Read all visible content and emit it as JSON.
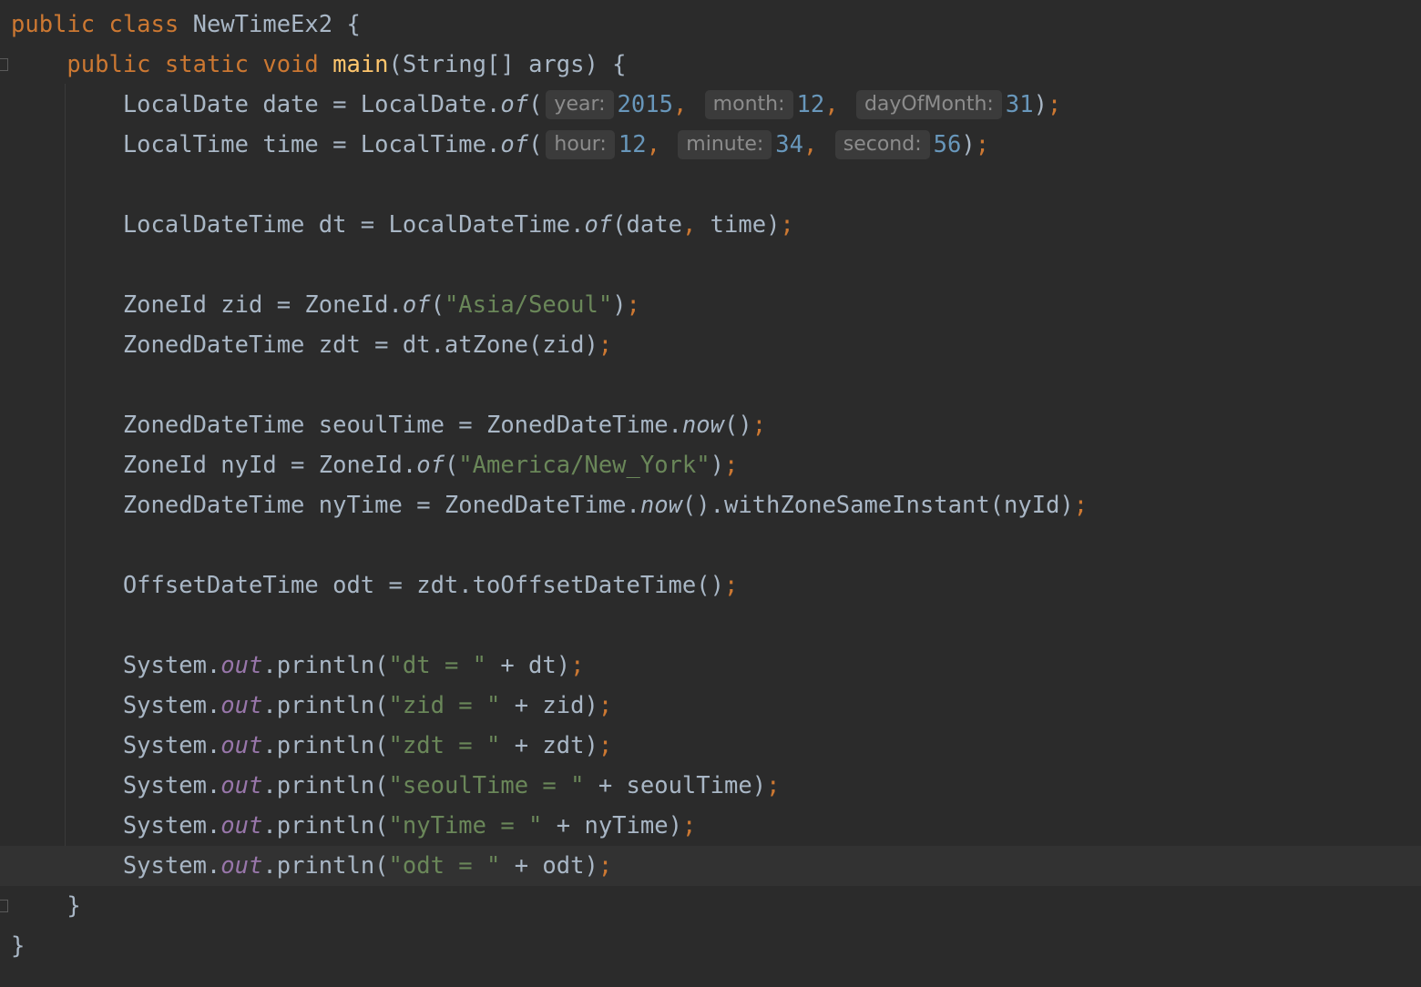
{
  "editor": {
    "lines": [
      {
        "tokens": [
          [
            "kw",
            "public "
          ],
          [
            "kw",
            "class "
          ],
          [
            "",
            "NewTimeEx2 {"
          ]
        ]
      },
      {
        "tokens": [
          [
            "",
            "    "
          ],
          [
            "kw",
            "public "
          ],
          [
            "kw",
            "static "
          ],
          [
            "kw",
            "void "
          ],
          [
            "fn",
            "main"
          ],
          [
            "",
            "(String[] args) {"
          ]
        ]
      },
      {
        "tokens": [
          [
            "",
            "        LocalDate date = LocalDate."
          ],
          [
            "it",
            "of"
          ],
          [
            "",
            "("
          ],
          [
            "hint",
            "year:"
          ],
          [
            "nu",
            "2015"
          ],
          [
            "cm",
            ", "
          ],
          [
            "hint",
            "month:"
          ],
          [
            "nu",
            "12"
          ],
          [
            "cm",
            ", "
          ],
          [
            "hint",
            "dayOfMonth:"
          ],
          [
            "nu",
            "31"
          ],
          [
            "",
            ")"
          ],
          [
            "semi",
            ";"
          ]
        ]
      },
      {
        "tokens": [
          [
            "",
            "        LocalTime time = LocalTime."
          ],
          [
            "it",
            "of"
          ],
          [
            "",
            "("
          ],
          [
            "hint",
            "hour:"
          ],
          [
            "nu",
            "12"
          ],
          [
            "cm",
            ", "
          ],
          [
            "hint",
            "minute:"
          ],
          [
            "nu",
            "34"
          ],
          [
            "cm",
            ", "
          ],
          [
            "hint",
            "second:"
          ],
          [
            "nu",
            "56"
          ],
          [
            "",
            ")"
          ],
          [
            "semi",
            ";"
          ]
        ]
      },
      {
        "tokens": []
      },
      {
        "tokens": [
          [
            "",
            "        LocalDateTime dt = LocalDateTime."
          ],
          [
            "it",
            "of"
          ],
          [
            "",
            "(date"
          ],
          [
            "cm",
            ", "
          ],
          [
            "",
            "time)"
          ],
          [
            "semi",
            ";"
          ]
        ]
      },
      {
        "tokens": []
      },
      {
        "tokens": [
          [
            "",
            "        ZoneId zid = ZoneId."
          ],
          [
            "it",
            "of"
          ],
          [
            "",
            "("
          ],
          [
            "st",
            "\"Asia/Seoul\""
          ],
          [
            "",
            ")"
          ],
          [
            "semi",
            ";"
          ]
        ]
      },
      {
        "tokens": [
          [
            "",
            "        ZonedDateTime zdt = dt.atZone(zid)"
          ],
          [
            "semi",
            ";"
          ]
        ]
      },
      {
        "tokens": []
      },
      {
        "tokens": [
          [
            "",
            "        ZonedDateTime seoulTime = ZonedDateTime."
          ],
          [
            "it",
            "now"
          ],
          [
            "",
            "()"
          ],
          [
            "semi",
            ";"
          ]
        ]
      },
      {
        "tokens": [
          [
            "",
            "        ZoneId nyId = ZoneId."
          ],
          [
            "it",
            "of"
          ],
          [
            "",
            "("
          ],
          [
            "st",
            "\"America/New_York\""
          ],
          [
            "",
            ")"
          ],
          [
            "semi",
            ";"
          ]
        ]
      },
      {
        "tokens": [
          [
            "",
            "        ZonedDateTime nyTime = ZonedDateTime."
          ],
          [
            "it",
            "now"
          ],
          [
            "",
            "().withZoneSameInstant(nyId)"
          ],
          [
            "semi",
            ";"
          ]
        ]
      },
      {
        "tokens": []
      },
      {
        "tokens": [
          [
            "",
            "        OffsetDateTime odt = zdt.toOffsetDateTime()"
          ],
          [
            "semi",
            ";"
          ]
        ]
      },
      {
        "tokens": []
      },
      {
        "tokens": [
          [
            "",
            "        System."
          ],
          [
            "fld",
            "out"
          ],
          [
            "",
            ".println("
          ],
          [
            "st",
            "\"dt = \""
          ],
          [
            "",
            " + dt)"
          ],
          [
            "semi",
            ";"
          ]
        ]
      },
      {
        "tokens": [
          [
            "",
            "        System."
          ],
          [
            "fld",
            "out"
          ],
          [
            "",
            ".println("
          ],
          [
            "st",
            "\"zid = \""
          ],
          [
            "",
            " + zid)"
          ],
          [
            "semi",
            ";"
          ]
        ]
      },
      {
        "tokens": [
          [
            "",
            "        System."
          ],
          [
            "fld",
            "out"
          ],
          [
            "",
            ".println("
          ],
          [
            "st",
            "\"zdt = \""
          ],
          [
            "",
            " + zdt)"
          ],
          [
            "semi",
            ";"
          ]
        ]
      },
      {
        "tokens": [
          [
            "",
            "        System."
          ],
          [
            "fld",
            "out"
          ],
          [
            "",
            ".println("
          ],
          [
            "st",
            "\"seoulTime = \""
          ],
          [
            "",
            " + seoulTime)"
          ],
          [
            "semi",
            ";"
          ]
        ]
      },
      {
        "tokens": [
          [
            "",
            "        System."
          ],
          [
            "fld",
            "out"
          ],
          [
            "",
            ".println("
          ],
          [
            "st",
            "\"nyTime = \""
          ],
          [
            "",
            " + nyTime)"
          ],
          [
            "semi",
            ";"
          ]
        ]
      },
      {
        "tokens": [
          [
            "",
            "        System."
          ],
          [
            "fld",
            "out"
          ],
          [
            "",
            ".println("
          ],
          [
            "st",
            "\"odt = \""
          ],
          [
            "",
            " + odt)"
          ],
          [
            "semi",
            ";"
          ]
        ],
        "current": true
      },
      {
        "tokens": [
          [
            "",
            "    }"
          ]
        ]
      },
      {
        "tokens": [
          [
            "",
            "}"
          ]
        ]
      }
    ]
  },
  "colors": {
    "background": "#2b2b2b",
    "keyword": "#cc7832",
    "method": "#ffc66d",
    "string": "#6a8759",
    "number": "#6897bb",
    "field": "#9876aa",
    "text": "#a9b7c6"
  }
}
